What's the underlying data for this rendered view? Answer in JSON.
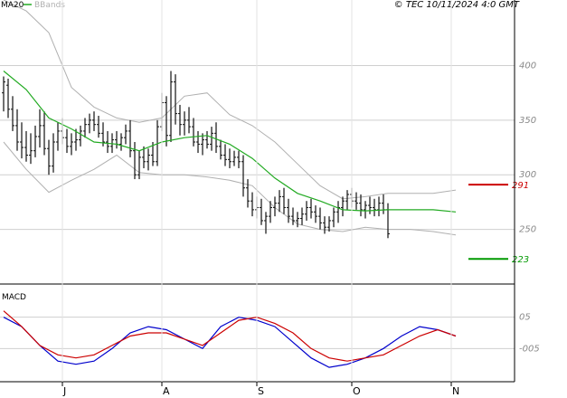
{
  "copyright": "© TEC 10/11/2024 4:0 GMT",
  "colors": {
    "price_bars": "#111111",
    "ma20": "#22aa22",
    "bbands": "#b0b0b0",
    "grid": "#cfcfcf",
    "axis": "#000000",
    "resistance": "#cc0000",
    "support": "#009900",
    "macd_line": "#0000cc",
    "signal_line": "#cc0000"
  },
  "chart_data": [
    {
      "type": "line",
      "panel": "price",
      "legend": [
        {
          "name": "MA20",
          "color": "#22aa22"
        },
        {
          "name": "BBands",
          "color": "#b0b0b0"
        }
      ],
      "y_ticks": [
        250,
        300,
        350,
        400
      ],
      "ylim": [
        200,
        460
      ],
      "x_ticks": [
        {
          "label": "J",
          "index": 13
        },
        {
          "label": "A",
          "index": 35
        },
        {
          "label": "S",
          "index": 56
        },
        {
          "label": "O",
          "index": 77
        },
        {
          "label": "N",
          "index": 99
        }
      ],
      "n_sessions": 104,
      "levels": [
        {
          "label": "291",
          "value": 291,
          "color": "#cc0000"
        },
        {
          "label": "223",
          "value": 223,
          "color": "#009900"
        }
      ],
      "ohlc": [
        [
          375,
          390,
          358,
          385
        ],
        [
          382,
          388,
          352,
          360
        ],
        [
          360,
          372,
          340,
          345
        ],
        [
          345,
          360,
          322,
          330
        ],
        [
          330,
          348,
          315,
          325
        ],
        [
          325,
          340,
          312,
          318
        ],
        [
          318,
          338,
          310,
          322
        ],
        [
          322,
          345,
          316,
          335
        ],
        [
          335,
          360,
          325,
          345
        ],
        [
          345,
          358,
          318,
          324
        ],
        [
          324,
          332,
          300,
          308
        ],
        [
          308,
          338,
          302,
          330
        ],
        [
          330,
          348,
          322,
          340
        ],
        [
          340,
          352,
          328,
          334
        ],
        [
          334,
          342,
          320,
          326
        ],
        [
          326,
          338,
          318,
          330
        ],
        [
          330,
          342,
          322,
          332
        ],
        [
          332,
          345,
          326,
          340
        ],
        [
          340,
          352,
          334,
          346
        ],
        [
          346,
          356,
          338,
          350
        ],
        [
          350,
          358,
          340,
          346
        ],
        [
          346,
          354,
          334,
          338
        ],
        [
          338,
          348,
          326,
          330
        ],
        [
          330,
          340,
          320,
          326
        ],
        [
          326,
          338,
          320,
          332
        ],
        [
          332,
          340,
          324,
          328
        ],
        [
          328,
          338,
          322,
          334
        ],
        [
          334,
          346,
          328,
          340
        ],
        [
          340,
          350,
          316,
          322
        ],
        [
          322,
          330,
          296,
          300
        ],
        [
          300,
          322,
          296,
          316
        ],
        [
          316,
          326,
          306,
          312
        ],
        [
          312,
          324,
          304,
          318
        ],
        [
          318,
          330,
          308,
          312
        ],
        [
          312,
          350,
          308,
          344
        ],
        [
          344,
          375,
          340,
          366
        ],
        [
          366,
          372,
          326,
          336
        ],
        [
          336,
          395,
          330,
          385
        ],
        [
          385,
          392,
          346,
          356
        ],
        [
          356,
          364,
          336,
          346
        ],
        [
          346,
          358,
          336,
          350
        ],
        [
          350,
          362,
          338,
          344
        ],
        [
          344,
          352,
          326,
          330
        ],
        [
          330,
          340,
          320,
          328
        ],
        [
          328,
          338,
          318,
          332
        ],
        [
          332,
          340,
          324,
          328
        ],
        [
          328,
          344,
          322,
          338
        ],
        [
          338,
          348,
          320,
          326
        ],
        [
          326,
          332,
          314,
          318
        ],
        [
          318,
          328,
          308,
          314
        ],
        [
          314,
          324,
          306,
          312
        ],
        [
          312,
          322,
          308,
          316
        ],
        [
          316,
          322,
          306,
          312
        ],
        [
          312,
          318,
          280,
          288
        ],
        [
          288,
          296,
          270,
          276
        ],
        [
          276,
          284,
          262,
          268
        ],
        [
          268,
          280,
          260,
          270
        ],
        [
          270,
          278,
          254,
          258
        ],
        [
          258,
          266,
          246,
          262
        ],
        [
          262,
          276,
          256,
          270
        ],
        [
          270,
          280,
          262,
          274
        ],
        [
          274,
          286,
          266,
          280
        ],
        [
          280,
          288,
          264,
          270
        ],
        [
          270,
          278,
          256,
          262
        ],
        [
          262,
          270,
          254,
          258
        ],
        [
          258,
          266,
          252,
          260
        ],
        [
          260,
          270,
          254,
          264
        ],
        [
          264,
          276,
          258,
          270
        ],
        [
          270,
          278,
          260,
          266
        ],
        [
          266,
          272,
          256,
          262
        ],
        [
          262,
          270,
          250,
          256
        ],
        [
          256,
          262,
          246,
          252
        ],
        [
          252,
          262,
          248,
          258
        ],
        [
          258,
          270,
          252,
          266
        ],
        [
          266,
          276,
          256,
          270
        ],
        [
          270,
          280,
          262,
          276
        ],
        [
          276,
          286,
          268,
          282
        ],
        [
          282,
          288,
          270,
          276
        ],
        [
          276,
          284,
          268,
          274
        ],
        [
          274,
          282,
          262,
          268
        ],
        [
          268,
          276,
          260,
          272
        ],
        [
          272,
          280,
          264,
          270
        ],
        [
          270,
          278,
          262,
          268
        ],
        [
          268,
          280,
          262,
          274
        ],
        [
          274,
          282,
          264,
          268
        ],
        [
          268,
          274,
          242,
          246
        ]
      ],
      "ma20": [
        [
          0,
          395
        ],
        [
          5,
          378
        ],
        [
          10,
          352
        ],
        [
          15,
          342
        ],
        [
          20,
          330
        ],
        [
          25,
          328
        ],
        [
          30,
          322
        ],
        [
          35,
          330
        ],
        [
          40,
          334
        ],
        [
          45,
          336
        ],
        [
          50,
          328
        ],
        [
          55,
          315
        ],
        [
          60,
          297
        ],
        [
          65,
          283
        ],
        [
          70,
          276
        ],
        [
          75,
          268
        ],
        [
          80,
          267
        ],
        [
          85,
          268
        ],
        [
          90,
          268
        ],
        [
          95,
          268
        ],
        [
          100,
          266
        ]
      ],
      "bband_upper": [
        [
          0,
          460
        ],
        [
          5,
          450
        ],
        [
          10,
          430
        ],
        [
          15,
          380
        ],
        [
          20,
          362
        ],
        [
          25,
          352
        ],
        [
          30,
          348
        ],
        [
          35,
          352
        ],
        [
          40,
          372
        ],
        [
          45,
          375
        ],
        [
          50,
          355
        ],
        [
          55,
          345
        ],
        [
          60,
          330
        ],
        [
          65,
          310
        ],
        [
          70,
          290
        ],
        [
          75,
          278
        ],
        [
          80,
          280
        ],
        [
          85,
          283
        ],
        [
          90,
          283
        ],
        [
          95,
          283
        ],
        [
          100,
          286
        ]
      ],
      "bband_lower": [
        [
          0,
          330
        ],
        [
          5,
          305
        ],
        [
          10,
          284
        ],
        [
          15,
          295
        ],
        [
          20,
          305
        ],
        [
          25,
          318
        ],
        [
          30,
          302
        ],
        [
          35,
          300
        ],
        [
          40,
          300
        ],
        [
          45,
          298
        ],
        [
          50,
          295
        ],
        [
          55,
          290
        ],
        [
          60,
          270
        ],
        [
          65,
          255
        ],
        [
          70,
          250
        ],
        [
          75,
          248
        ],
        [
          80,
          252
        ],
        [
          85,
          250
        ],
        [
          90,
          250
        ],
        [
          95,
          248
        ],
        [
          100,
          245
        ]
      ]
    },
    {
      "type": "line",
      "panel": "macd",
      "title": "MACD",
      "y_ticks": [
        {
          "label": "05",
          "value": 0.05
        },
        {
          "label": "-005",
          "value": -0.05
        }
      ],
      "ylim": [
        -0.15,
        0.15
      ],
      "series": [
        {
          "color": "#0000cc",
          "points": [
            [
              0,
              0.05
            ],
            [
              4,
              0.02
            ],
            [
              8,
              -0.04
            ],
            [
              12,
              -0.09
            ],
            [
              16,
              -0.1
            ],
            [
              20,
              -0.09
            ],
            [
              24,
              -0.05
            ],
            [
              28,
              0.0
            ],
            [
              32,
              0.02
            ],
            [
              36,
              0.01
            ],
            [
              40,
              -0.02
            ],
            [
              44,
              -0.05
            ],
            [
              48,
              0.02
            ],
            [
              52,
              0.05
            ],
            [
              56,
              0.04
            ],
            [
              60,
              0.02
            ],
            [
              64,
              -0.03
            ],
            [
              68,
              -0.08
            ],
            [
              72,
              -0.11
            ],
            [
              76,
              -0.1
            ],
            [
              80,
              -0.08
            ],
            [
              84,
              -0.05
            ],
            [
              88,
              -0.01
            ],
            [
              92,
              0.02
            ],
            [
              96,
              0.01
            ],
            [
              100,
              -0.01
            ]
          ]
        },
        {
          "color": "#cc0000",
          "points": [
            [
              0,
              0.07
            ],
            [
              4,
              0.02
            ],
            [
              8,
              -0.04
            ],
            [
              12,
              -0.07
            ],
            [
              16,
              -0.08
            ],
            [
              20,
              -0.07
            ],
            [
              24,
              -0.04
            ],
            [
              28,
              -0.01
            ],
            [
              32,
              0.0
            ],
            [
              36,
              0.0
            ],
            [
              40,
              -0.02
            ],
            [
              44,
              -0.04
            ],
            [
              48,
              0.0
            ],
            [
              52,
              0.04
            ],
            [
              56,
              0.05
            ],
            [
              60,
              0.03
            ],
            [
              64,
              0.0
            ],
            [
              68,
              -0.05
            ],
            [
              72,
              -0.08
            ],
            [
              76,
              -0.09
            ],
            [
              80,
              -0.08
            ],
            [
              84,
              -0.07
            ],
            [
              88,
              -0.04
            ],
            [
              92,
              -0.01
            ],
            [
              96,
              0.01
            ],
            [
              100,
              -0.01
            ]
          ]
        }
      ]
    }
  ]
}
